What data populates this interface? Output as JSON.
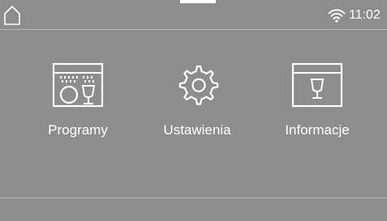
{
  "status_bar": {
    "home_icon": "home-icon",
    "wifi_icon": "wifi-icon",
    "time": "11:02"
  },
  "menu": {
    "tiles": [
      {
        "label": "Programy",
        "icon": "dishwasher-programs-icon"
      },
      {
        "label": "Ustawienia",
        "icon": "gear-icon"
      },
      {
        "label": "Informacje",
        "icon": "wine-glass-info-icon"
      }
    ]
  },
  "colors": {
    "background": "#8d8d8d",
    "foreground": "#ffffff",
    "divider": "#b8b8b8"
  }
}
